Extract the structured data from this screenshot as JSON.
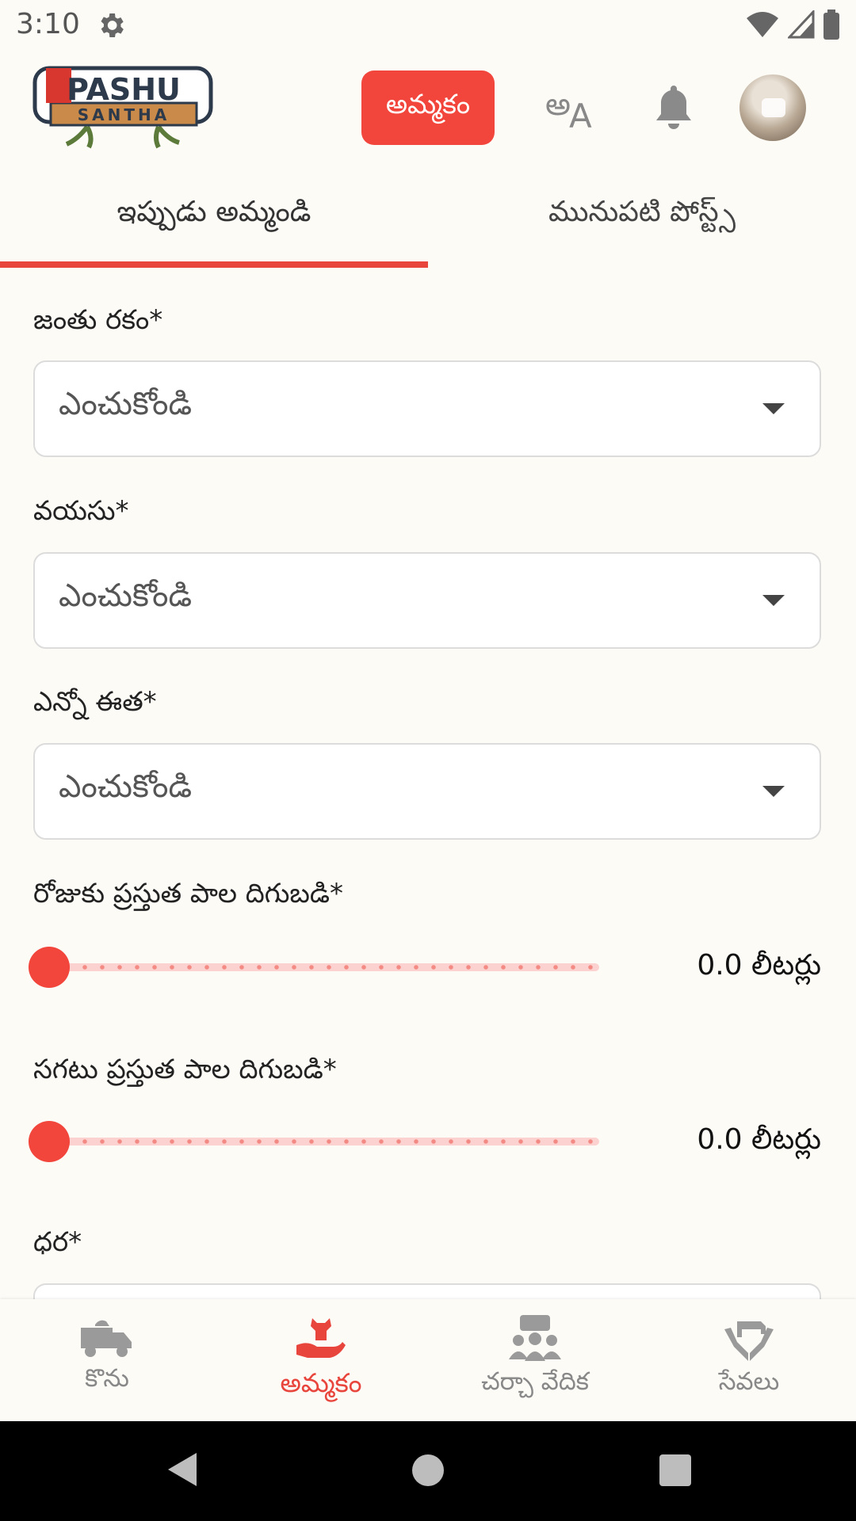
{
  "status_bar": {
    "time": "3:10",
    "icons": [
      "settings-icon",
      "wifi-icon",
      "signal-icon",
      "battery-icon"
    ]
  },
  "header": {
    "logo_text_top": "PASHU",
    "logo_text_bottom": "SANTHA",
    "sell_button_label": "అమ్మకం",
    "icons": [
      "language-icon",
      "bell-icon",
      "avatar"
    ]
  },
  "tabs": [
    {
      "label": "ఇప్పుడు అమ్మండి",
      "active": true
    },
    {
      "label": "మునుపటి పోస్ట్స్",
      "active": false
    }
  ],
  "form": {
    "animal_type": {
      "label": "జంతు రకం*",
      "placeholder": "ఎంచుకోండి"
    },
    "age": {
      "label": "వయసు*",
      "placeholder": "ఎంచుకోండి"
    },
    "calving": {
      "label": "ఎన్నో ఈత*",
      "placeholder": "ఎంచుకోండి"
    },
    "milk_per_day": {
      "label": "రోజుకు ప్రస్తుత పాల దిగుబడి*",
      "value": "0.0 లీటర్లు",
      "fraction": 0.0
    },
    "avg_milk": {
      "label": "సగటు ప్రస్తుత పాల దిగుబడి*",
      "value": "0.0 లీటర్లు",
      "fraction": 0.0
    },
    "price": {
      "label": "ధర*"
    }
  },
  "bottom_nav": [
    {
      "label": "కొను",
      "icon": "truck-icon",
      "active": false
    },
    {
      "label": "అమ్మకం",
      "icon": "cow-hand-icon",
      "active": true
    },
    {
      "label": "చర్చా వేదిక",
      "icon": "community-icon",
      "active": false
    },
    {
      "label": "సేవలు",
      "icon": "service-hands-icon",
      "active": false
    }
  ],
  "colors": {
    "accent": "#f2453b",
    "background": "#fdfbf6",
    "track": "#fbd2cf"
  }
}
